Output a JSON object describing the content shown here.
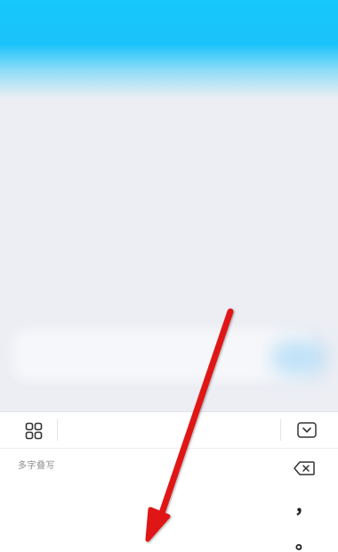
{
  "screen": {
    "accent_color": "#16c8fb",
    "background_color": "#eceef4"
  },
  "keyboard": {
    "toolbar": {
      "grid_icon": "grid-icon",
      "collapse_icon": "chevron-down-icon"
    },
    "handwriting_hint": "多字叠写",
    "side_keys": {
      "backspace_icon": "backspace-icon",
      "comma": "，",
      "period": "。"
    }
  },
  "annotation": {
    "arrow_color": "#e01414",
    "direction": "down-left"
  }
}
